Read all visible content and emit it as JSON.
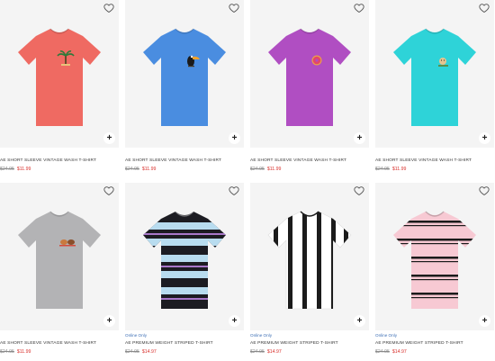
{
  "colors": {
    "sale_price": "#d9302c",
    "online_only": "#3d6fb5",
    "image_bg": "#f4f4f4"
  },
  "products": [
    {
      "name": "AE SHORT SLEEVE VINTAGE WASH T-SHIRT",
      "price_original": "$24.95",
      "price_sale": "$11.99",
      "online_only": "",
      "color": "#ef6a62",
      "graphic": "palm-tree-graphic"
    },
    {
      "name": "AE SHORT SLEEVE VINTAGE WASH T-SHIRT",
      "price_original": "$24.95",
      "price_sale": "$11.99",
      "online_only": "",
      "color": "#4a8de0",
      "graphic": "toucan-graphic"
    },
    {
      "name": "AE SHORT SLEEVE VINTAGE WASH T-SHIRT",
      "price_original": "$24.95",
      "price_sale": "$11.99",
      "online_only": "",
      "color": "#b04ec2",
      "graphic": "donut-graphic"
    },
    {
      "name": "AE SHORT SLEEVE VINTAGE WASH T-SHIRT",
      "price_original": "$24.95",
      "price_sale": "$11.99",
      "online_only": "",
      "color": "#2ed3d8",
      "graphic": "dog-graphic"
    },
    {
      "name": "AE SHORT SLEEVE VINTAGE WASH T-SHIRT",
      "price_original": "$24.95",
      "price_sale": "$11.99",
      "online_only": "",
      "color": "#b3b3b5",
      "graphic": "animals-graphic"
    },
    {
      "name": "AE PREMIUM WEIGHT STRIPED T-SHIRT",
      "price_original": "$24.95",
      "price_sale": "$14.97",
      "online_only": "Online Only",
      "color": "#1c1c22",
      "graphic": "horizontal-stripes-blue"
    },
    {
      "name": "AE PREMIUM WEIGHT STRIPED T-SHIRT",
      "price_original": "$24.95",
      "price_sale": "$14.97",
      "online_only": "Online Only",
      "color": "#ffffff",
      "graphic": "vertical-stripes-black"
    },
    {
      "name": "AE PREMIUM WEIGHT STRIPED T-SHIRT",
      "price_original": "$24.95",
      "price_sale": "$14.97",
      "online_only": "Online Only",
      "color": "#f7c9d3",
      "graphic": "horizontal-stripes-pink"
    }
  ]
}
